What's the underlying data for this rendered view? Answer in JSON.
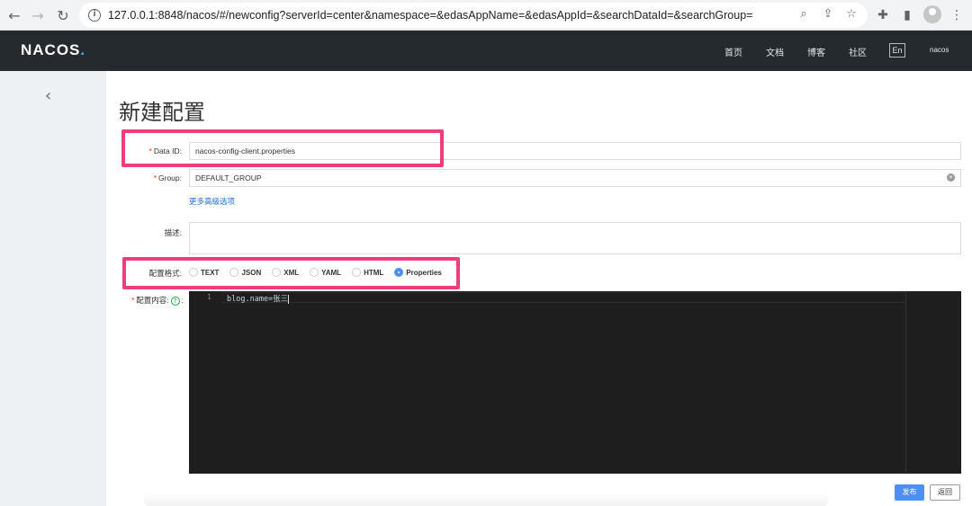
{
  "browser": {
    "url": "127.0.0.1:8848/nacos/#/newconfig?serverId=center&namespace=&edasAppName=&edasAppId=&searchDataId=&searchGroup="
  },
  "header": {
    "logo_main": "NACOS",
    "logo_dot": ".",
    "nav": [
      "首页",
      "文档",
      "博客",
      "社区"
    ],
    "lang": "En",
    "user": "nacos"
  },
  "page": {
    "title": "新建配置",
    "data_id_label": "Data ID:",
    "data_id_value": "nacos-config-client.properties",
    "group_label": "Group:",
    "group_value": "DEFAULT_GROUP",
    "advanced_link": "更多高级选项",
    "desc_label": "描述:",
    "format_label": "配置格式:",
    "formats": [
      "TEXT",
      "JSON",
      "XML",
      "YAML",
      "HTML",
      "Properties"
    ],
    "selected_format": "Properties",
    "content_label": "配置内容:",
    "content_colon": ":",
    "editor_line_number": "1",
    "editor_code": "blog.name=张三",
    "publish_button": "发布",
    "back_button": "返回"
  },
  "colors": {
    "header_bg": "#252a2f",
    "primary": "#4f8ef7",
    "highlight": "#ee3d7d",
    "editor_bg": "#1e1e1e"
  }
}
